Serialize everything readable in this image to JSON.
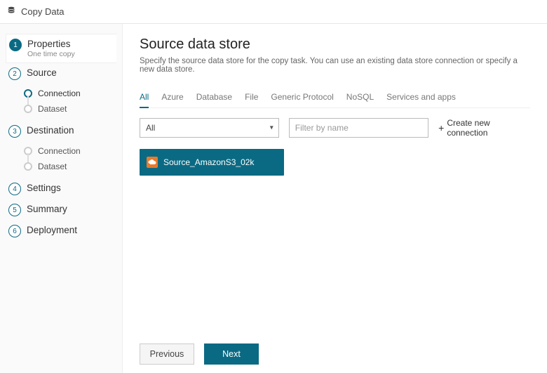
{
  "topbar": {
    "title": "Copy Data"
  },
  "sidebar": {
    "steps": [
      {
        "num": "1",
        "label": "Properties",
        "sublabel": "One time copy"
      },
      {
        "num": "2",
        "label": "Source"
      },
      {
        "num": "3",
        "label": "Destination"
      },
      {
        "num": "4",
        "label": "Settings"
      },
      {
        "num": "5",
        "label": "Summary"
      },
      {
        "num": "6",
        "label": "Deployment"
      }
    ],
    "source_substeps": [
      {
        "label": "Connection"
      },
      {
        "label": "Dataset"
      }
    ],
    "dest_substeps": [
      {
        "label": "Connection"
      },
      {
        "label": "Dataset"
      }
    ]
  },
  "main": {
    "heading": "Source data store",
    "description": "Specify the source data store for the copy task. You can use an existing data store connection or specify a new data store.",
    "tabs": [
      "All",
      "Azure",
      "Database",
      "File",
      "Generic Protocol",
      "NoSQL",
      "Services and apps"
    ],
    "active_tab_index": 0,
    "filter_select_value": "All",
    "filter_placeholder": "Filter by name",
    "create_label": "Create new connection",
    "connections": [
      {
        "name": "Source_AmazonS3_02k"
      }
    ]
  },
  "footer": {
    "prev": "Previous",
    "next": "Next"
  }
}
